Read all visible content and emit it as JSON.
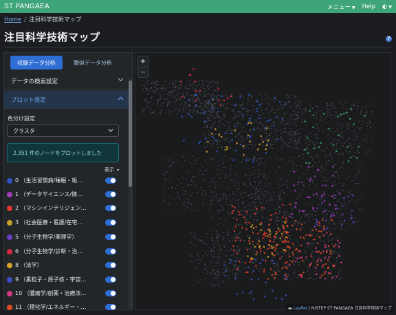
{
  "app": {
    "brand": "ST PANGAEA",
    "menu_label": "メニュー",
    "help_label": "Help",
    "theme_icon": "half-circle-icon"
  },
  "breadcrumb": {
    "home": "Home",
    "current": "注目科学技術マップ"
  },
  "page": {
    "title": "注目科学技術マップ",
    "help_icon": "?"
  },
  "tabs": [
    {
      "label": "収録データ分析",
      "active": true
    },
    {
      "label": "類似データ分析",
      "active": false
    }
  ],
  "accordion": {
    "search": "データの検索設定",
    "plot": "プロット設定"
  },
  "plot_settings": {
    "color_label": "色分け設定",
    "color_value": "クラスタ",
    "info": "2,351 件のノードをプロットしました",
    "display_label": "表示"
  },
  "clusters": [
    {
      "label": "0 （生活習慣病/睡眠・吸…",
      "color": "#2d52c4",
      "on": true
    },
    {
      "label": "1 （データサイエンス/情…",
      "color": "#a13bb8",
      "on": true
    },
    {
      "label": "2 （マシンインテリジェン…",
      "color": "#e3372e",
      "on": true
    },
    {
      "label": "3 （社会医療・看護/在宅…",
      "color": "#c9a227",
      "on": true
    },
    {
      "label": "5 （分子生物学/薬理学）",
      "color": "#6a3fc2",
      "on": true
    },
    {
      "label": "6 （分子生物学/診断・治…",
      "color": "#d7283e",
      "on": true
    },
    {
      "label": "8 （法学）",
      "color": "#d9a32b",
      "on": true
    },
    {
      "label": "9 （素粒子・原子核・宇宙…",
      "color": "#3950c6",
      "on": true
    },
    {
      "label": "10 （腫瘍学/創薬・治療法…",
      "color": "#d63a82",
      "on": true
    },
    {
      "label": "11 （理化学/エネルギー・…",
      "color": "#e04a23",
      "on": true
    }
  ],
  "map": {
    "zoom_in": "+",
    "zoom_out": "−",
    "attribution_link": "Leaflet",
    "attribution_text": " | NISTEP ST PANGAEA 注目科学技術マップ"
  }
}
